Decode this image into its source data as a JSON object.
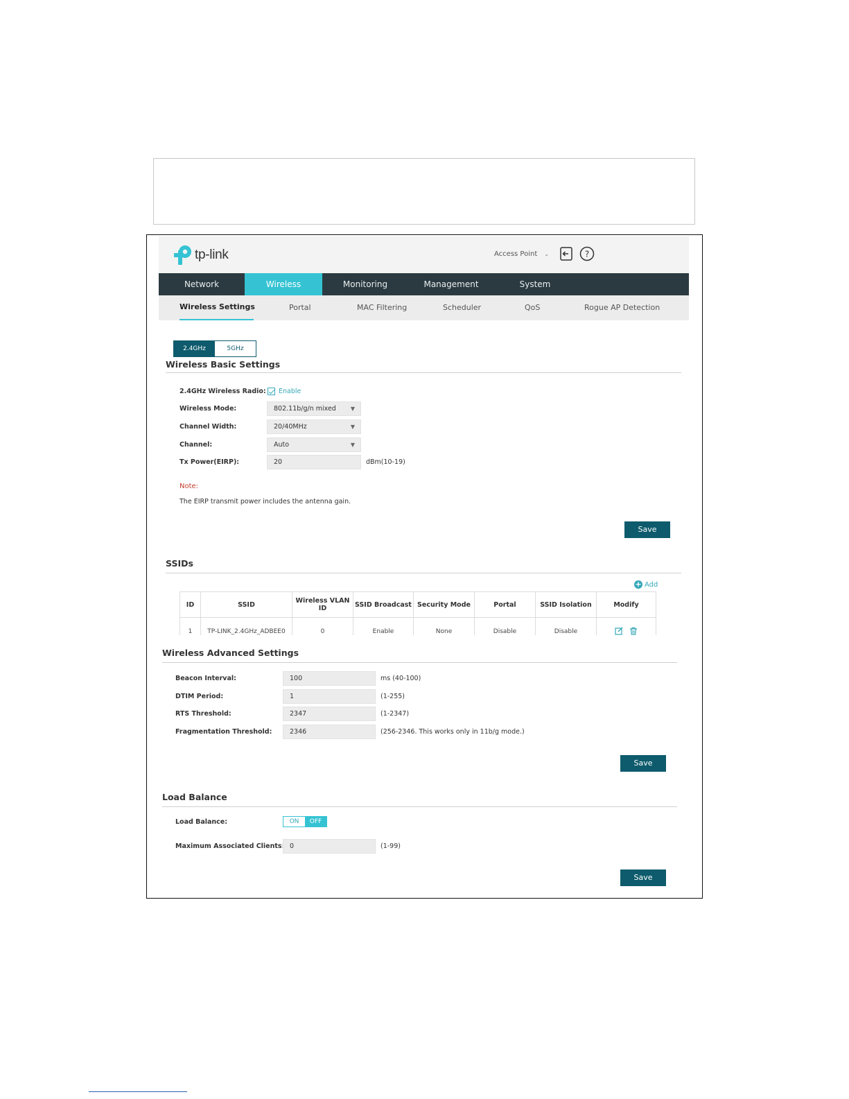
{
  "header": {
    "logo_text": "tp-link",
    "mode": "Access Point"
  },
  "main_nav": [
    "Network",
    "Wireless",
    "Monitoring",
    "Management",
    "System"
  ],
  "sub_nav": [
    "Wireless Settings",
    "Portal",
    "MAC Filtering",
    "Scheduler",
    "QoS",
    "Rogue AP Detection"
  ],
  "band_tabs": [
    "2.4GHz",
    "5GHz"
  ],
  "basic": {
    "title": "Wireless Basic Settings",
    "radio_label": "2.4GHz Wireless Radio:",
    "radio_value": "Enable",
    "mode_label": "Wireless Mode:",
    "mode_value": "802.11b/g/n mixed",
    "width_label": "Channel Width:",
    "width_value": "20/40MHz",
    "channel_label": "Channel:",
    "channel_value": "Auto",
    "tx_label": "Tx Power(EIRP):",
    "tx_value": "20",
    "tx_hint": "dBm(10-19)",
    "note_title": "Note:",
    "note_text": "The EIRP transmit power includes the antenna gain.",
    "save": "Save"
  },
  "ssids": {
    "title": "SSIDs",
    "add": "Add",
    "columns": [
      "ID",
      "SSID",
      "Wireless VLAN ID",
      "SSID Broadcast",
      "Security Mode",
      "Portal",
      "SSID Isolation",
      "Modify"
    ],
    "rows": [
      [
        "1",
        "TP-LINK_2.4GHz_ADBEE0",
        "0",
        "Enable",
        "None",
        "Disable",
        "Disable"
      ]
    ]
  },
  "advanced": {
    "title": "Wireless Advanced Settings",
    "beacon_label": "Beacon Interval:",
    "beacon_value": "100",
    "beacon_hint": "ms (40-100)",
    "dtim_label": "DTIM Period:",
    "dtim_value": "1",
    "dtim_hint": "(1-255)",
    "rts_label": "RTS Threshold:",
    "rts_value": "2347",
    "rts_hint": "(1-2347)",
    "frag_label": "Fragmentation Threshold:",
    "frag_value": "2346",
    "frag_hint": "(256-2346. This works only in 11b/g mode.)",
    "save": "Save"
  },
  "load_balance": {
    "title": "Load Balance",
    "lb_label": "Load Balance:",
    "toggle_on": "ON",
    "toggle_off": "OFF",
    "max_label": "Maximum Associated Clients:",
    "max_value": "0",
    "max_hint": "(1-99)",
    "save": "Save"
  },
  "colors": {
    "nav_bg": "#2b3a40",
    "accent": "#35c3d3",
    "button": "#0d5b6c",
    "note": "#c0392b"
  }
}
